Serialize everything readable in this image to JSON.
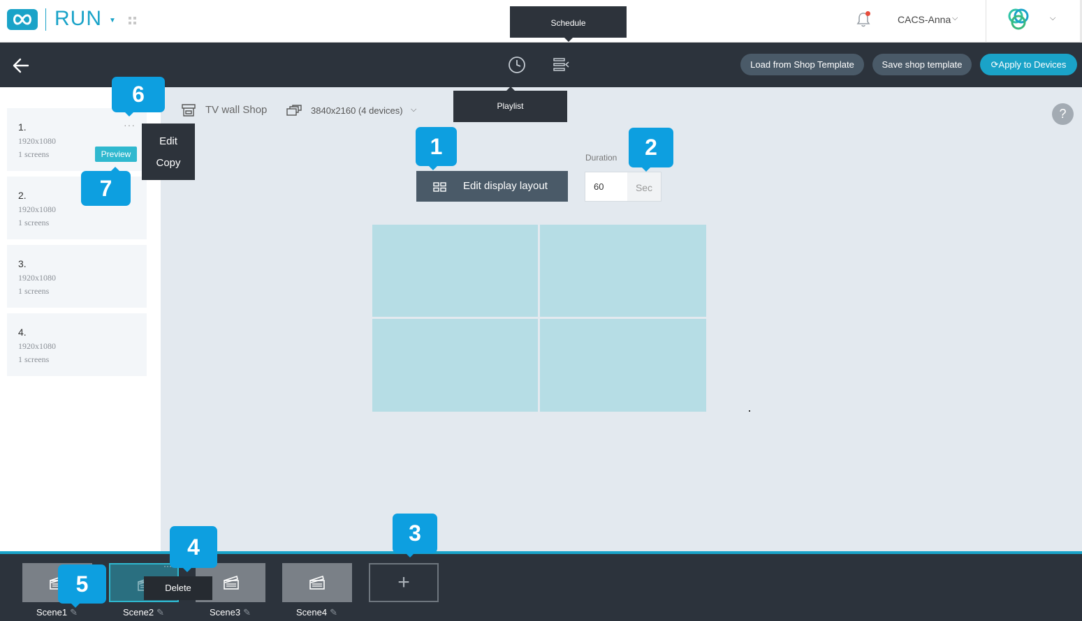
{
  "header": {
    "app_name": "RUN",
    "user_name": "CACS-Anna"
  },
  "tooltips": {
    "schedule": "Schedule",
    "playlist": "Playlist"
  },
  "toolbar": {
    "load_template": "Load from Shop Template",
    "save_template": "Save shop template",
    "apply_devices": "Apply to Devices"
  },
  "layouts": [
    {
      "num": "1.",
      "res": "1920x1080",
      "screens": "1 screens",
      "preview_label": "Preview"
    },
    {
      "num": "2.",
      "res": "1920x1080",
      "screens": "1 screens"
    },
    {
      "num": "3.",
      "res": "1920x1080",
      "screens": "1 screens"
    },
    {
      "num": "4.",
      "res": "1920x1080",
      "screens": "1 screens"
    }
  ],
  "context_menu": {
    "edit": "Edit",
    "copy": "Copy"
  },
  "main": {
    "shop_name": "TV wall Shop",
    "devices": "3840x2160 (4 devices)",
    "help": "?",
    "edit_layout_label": "Edit display layout",
    "duration_label": "Duration",
    "duration_value": "60",
    "duration_unit": "Sec"
  },
  "markers": [
    "1",
    "2",
    "3",
    "4",
    "5",
    "6",
    "7"
  ],
  "scenes": [
    {
      "label": "Scene1"
    },
    {
      "label": "Scene2",
      "active": true
    },
    {
      "label": "Scene3"
    },
    {
      "label": "Scene4"
    }
  ],
  "scene_menu": {
    "more": "···",
    "delete": "Delete"
  },
  "add_scene": "+",
  "colors": {
    "accent": "#1aa3c8",
    "dark": "#2c333c",
    "marker": "#0d9fe0",
    "screen_cell": "#b6dde5"
  }
}
